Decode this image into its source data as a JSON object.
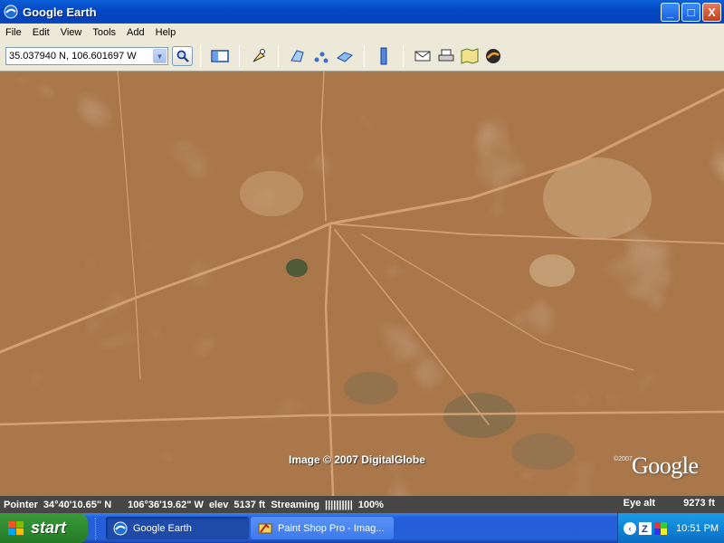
{
  "window": {
    "title": "Google Earth",
    "buttons": {
      "minimize": "_",
      "maximize": "□",
      "close": "X"
    }
  },
  "menu": [
    "File",
    "Edit",
    "View",
    "Tools",
    "Add",
    "Help"
  ],
  "toolbar": {
    "search_value": "35.037940 N, 106.601697 W",
    "icons": [
      "sidebar-icon",
      "placemark-icon",
      "polygon-icon",
      "path-icon",
      "image-overlay-icon",
      "ruler-icon",
      "email-icon",
      "print-icon",
      "map-icon",
      "sky-icon"
    ]
  },
  "map": {
    "imagery_credit": "Image © 2007 DigitalGlobe",
    "logo": "Google",
    "logo_small": "©2007"
  },
  "status": {
    "pointer_label": "Pointer",
    "lat": "34°40'10.65\" N",
    "lon": "106°36'19.62\" W",
    "elev_label": "elev",
    "elev_value": "5137 ft",
    "streaming_label": "Streaming",
    "streaming_bar": "||||||||||",
    "streaming_pct": "100%",
    "eye_alt_label": "Eye alt",
    "eye_alt_value": "9273 ft"
  },
  "taskbar": {
    "start_label": "start",
    "tasks": [
      {
        "label": "Google Earth",
        "active": true
      },
      {
        "label": "Paint Shop Pro - Imag...",
        "active": false
      }
    ],
    "clock": "10:51 PM"
  }
}
